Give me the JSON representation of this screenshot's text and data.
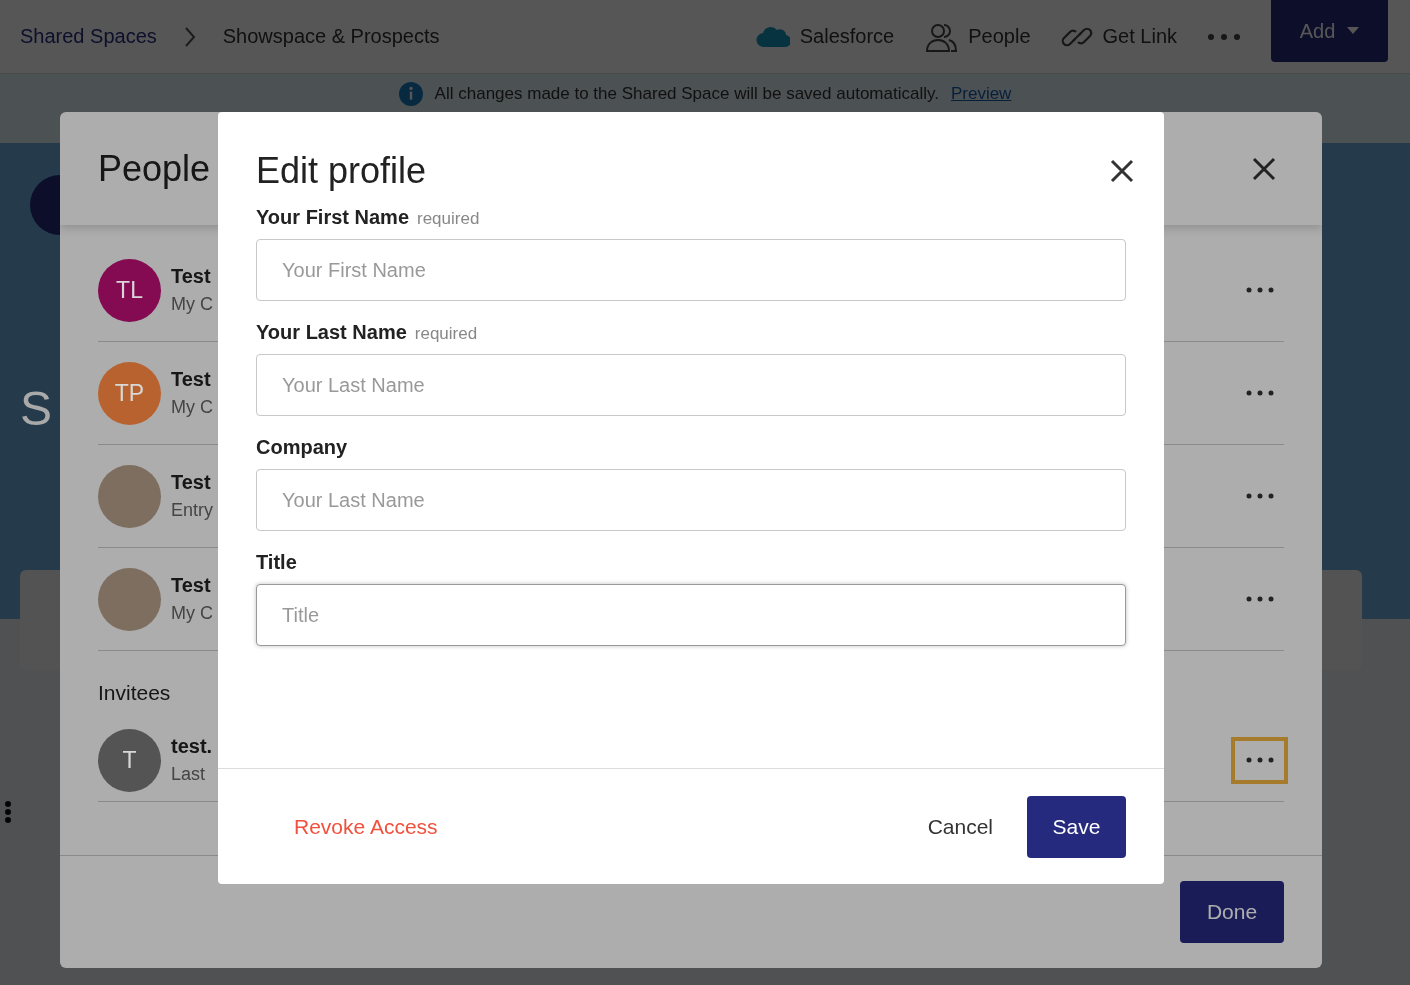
{
  "topbar": {
    "breadcrumbs": [
      "Shared Spaces",
      "Showspace & Prospects"
    ],
    "actions": [
      {
        "kind": "salesforce",
        "label": "Salesforce"
      },
      {
        "kind": "people",
        "label": "People"
      },
      {
        "kind": "link",
        "label": "Get Link"
      }
    ],
    "add_button": "Add"
  },
  "banner": {
    "text": "All changes made to the Shared Space will be saved automatically.",
    "link": "Preview"
  },
  "hero_title": "S",
  "people_dialog": {
    "title": "People",
    "members": [
      {
        "initials": "TL",
        "color": "#840b52",
        "photo": false,
        "name": "Test",
        "subtitle": "My C"
      },
      {
        "initials": "TP",
        "color": "#b8632f",
        "photo": false,
        "name": "Test",
        "subtitle": "My C"
      },
      {
        "photo": true,
        "name": "Test",
        "subtitle": "Entry"
      },
      {
        "photo": true,
        "name": "Test",
        "subtitle": "My C"
      }
    ],
    "invitees_label": "Invitees",
    "invitees": [
      {
        "initials": "T",
        "color": "#545454",
        "name": "test.",
        "subtitle": "Last",
        "focused": true
      }
    ],
    "done_button": "Done"
  },
  "edit_dialog": {
    "title": "Edit profile",
    "fields": [
      {
        "label": "Your First Name",
        "hint": "required",
        "placeholder": "Your First Name",
        "focused": false
      },
      {
        "label": "Your Last Name",
        "hint": "required",
        "placeholder": "Your Last Name",
        "focused": false
      },
      {
        "label": "Company",
        "placeholder": "Your Last Name",
        "focused": false
      },
      {
        "label": "Title",
        "placeholder": "Title",
        "focused": true
      }
    ],
    "revoke_button": "Revoke Access",
    "cancel_button": "Cancel",
    "save_button": "Save"
  }
}
